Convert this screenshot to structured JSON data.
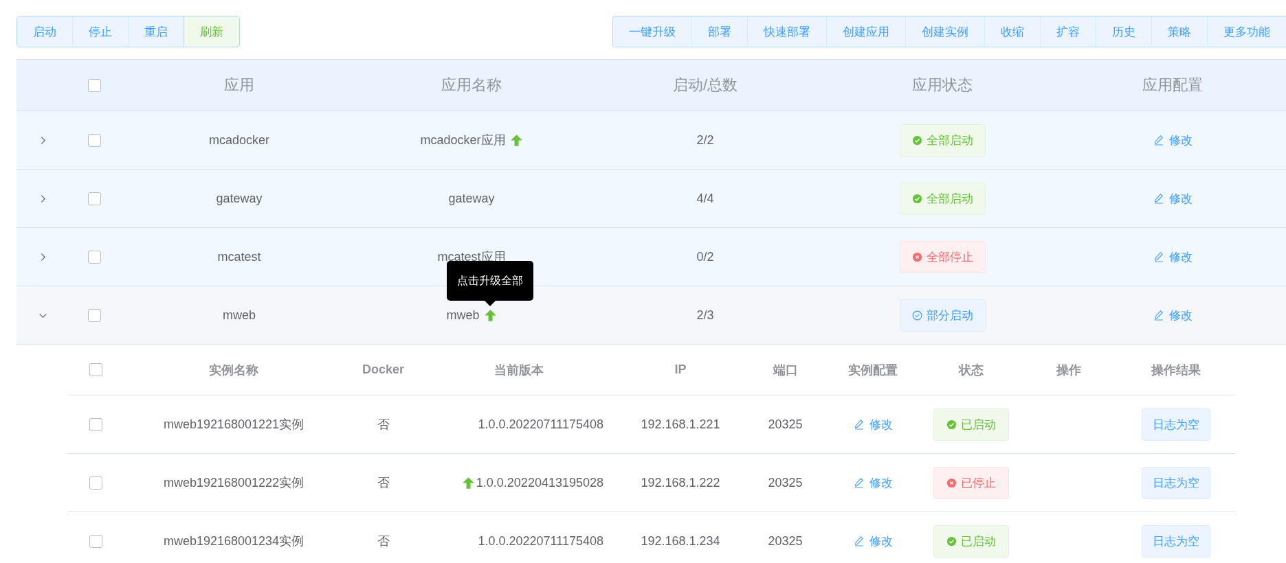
{
  "toolbar": {
    "left": [
      {
        "label": "启动",
        "highlighted": false
      },
      {
        "label": "停止",
        "highlighted": false
      },
      {
        "label": "重启",
        "highlighted": false
      },
      {
        "label": "刷新",
        "highlighted": true
      }
    ],
    "right": [
      {
        "label": "一键升级",
        "highlighted": false
      },
      {
        "label": "部署",
        "highlighted": false
      },
      {
        "label": "快速部署",
        "highlighted": false
      },
      {
        "label": "创建应用",
        "highlighted": false
      },
      {
        "label": "创建实例",
        "highlighted": false
      },
      {
        "label": "收缩",
        "highlighted": false
      },
      {
        "label": "扩容",
        "highlighted": false
      },
      {
        "label": "历史",
        "highlighted": false
      },
      {
        "label": "策略",
        "highlighted": false
      },
      {
        "label": "更多功能",
        "highlighted": false
      }
    ]
  },
  "table": {
    "header_checked": false,
    "columns": [
      "应用",
      "应用名称",
      "启动/总数",
      "应用状态",
      "应用配置"
    ],
    "rows": [
      {
        "expanded": false,
        "checked": false,
        "app": "mcadocker",
        "name": "mcadocker应用",
        "upgrade": true,
        "count": "2/2",
        "status": {
          "kind": "success",
          "label": "全部启动"
        },
        "config": "修改"
      },
      {
        "expanded": false,
        "checked": false,
        "app": "gateway",
        "name": "gateway",
        "upgrade": false,
        "count": "4/4",
        "status": {
          "kind": "success",
          "label": "全部启动"
        },
        "config": "修改"
      },
      {
        "expanded": false,
        "checked": false,
        "app": "mcatest",
        "name": "mcatest应用",
        "upgrade": false,
        "count": "0/2",
        "status": {
          "kind": "danger",
          "label": "全部停止"
        },
        "config": "修改"
      },
      {
        "expanded": true,
        "checked": false,
        "app": "mweb",
        "name": "mweb",
        "upgrade": true,
        "tooltip": "点击升级全部",
        "count": "2/3",
        "status": {
          "kind": "partial",
          "label": "部分启动"
        },
        "config": "修改",
        "instances": {
          "header_checked": false,
          "columns": [
            "实例名称",
            "Docker",
            "当前版本",
            "IP",
            "端口",
            "实例配置",
            "状态",
            "操作",
            "操作结果"
          ],
          "rows": [
            {
              "checked": false,
              "name": "mweb192168001221实例",
              "docker": "否",
              "upgrade": false,
              "version": "1.0.0.20220711175408",
              "ip": "192.168.1.221",
              "port": "20325",
              "config": "修改",
              "status": {
                "kind": "success",
                "label": "已启动"
              },
              "result": "日志为空"
            },
            {
              "checked": false,
              "name": "mweb192168001222实例",
              "docker": "否",
              "upgrade": true,
              "version": "1.0.0.20220413195028",
              "ip": "192.168.1.222",
              "port": "20325",
              "config": "修改",
              "status": {
                "kind": "danger",
                "label": "已停止"
              },
              "result": "日志为空"
            },
            {
              "checked": false,
              "name": "mweb192168001234实例",
              "docker": "否",
              "upgrade": false,
              "version": "1.0.0.20220711175408",
              "ip": "192.168.1.234",
              "port": "20325",
              "config": "修改",
              "status": {
                "kind": "success",
                "label": "已启动"
              },
              "result": "日志为空"
            }
          ]
        }
      }
    ]
  }
}
